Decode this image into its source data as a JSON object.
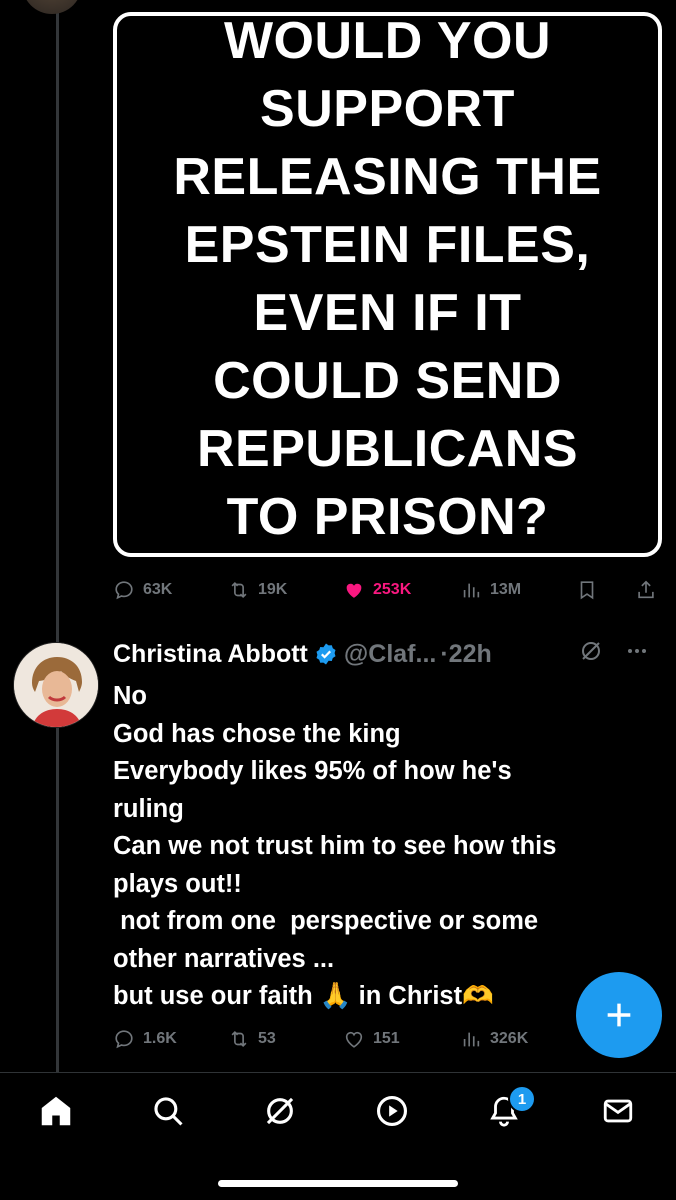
{
  "post": {
    "image_text": "WOULD YOU\nSUPPORT\nRELEASING THE\nEPSTEIN FILES,\nEVEN IF IT\nCOULD SEND\nREPUBLICANS\nTO PRISON?",
    "stats": {
      "replies": "63K",
      "reposts": "19K",
      "likes": "253K",
      "views": "13M"
    }
  },
  "reply": {
    "name": "Christina Abbott",
    "handle": "@Claf...",
    "time": "·22h",
    "body_lines": [
      "No",
      "God has chose the king",
      "Everybody likes 95% of how he's",
      "ruling",
      "Can we not trust him to see how this",
      "plays out!!",
      " not from one  perspective or some",
      "other narratives ...",
      "but use our faith 🙏 in Christ🫶"
    ],
    "stats": {
      "replies": "1.6K",
      "reposts": "53",
      "likes": "151",
      "views": "326K"
    }
  },
  "nav": {
    "notifications_badge": "1"
  },
  "colors": {
    "accent": "#1d9bf0",
    "like": "#f91880",
    "muted": "#71767b"
  }
}
